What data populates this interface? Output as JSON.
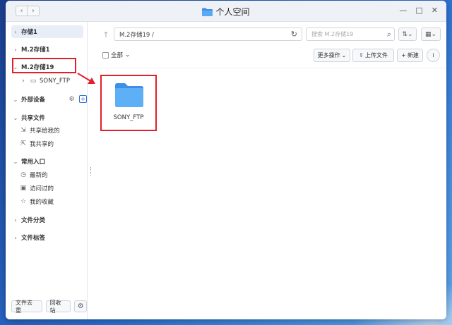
{
  "window": {
    "title": "个人空间",
    "nav_back": "‹",
    "nav_forward": "›",
    "controls": {
      "close": "✕",
      "maximize": "□",
      "minimize": "—"
    }
  },
  "sidebar": {
    "storage1": "存储1",
    "m2_storage1": "M.2存储1",
    "m2_storage19": "M.2存储19",
    "sony_ftp": "SONY_FTP",
    "external": "外部设备",
    "shared_files": "共享文件",
    "shared_with_me": "共享给我的",
    "my_shares": "我共享的",
    "common_entry": "常用入口",
    "recent": "最新的",
    "visited": "访问过的",
    "favorites": "我的收藏",
    "file_category": "文件分类",
    "file_tags": "文件标签",
    "dedupe": "文件去重",
    "recycle": "回收站"
  },
  "toolbar": {
    "path": "M.2存储19 /",
    "search_placeholder": "搜索 M.2存储19",
    "select_all": "全部",
    "more_actions": "更多操作",
    "upload": "上传文件",
    "new": "新建",
    "info": "i"
  },
  "files": [
    {
      "name": "SONY_FTP",
      "type": "folder"
    }
  ],
  "colors": {
    "accent": "#2b6fd6",
    "highlight_red": "#e0202a",
    "folder_blue": "#4da3f0"
  }
}
